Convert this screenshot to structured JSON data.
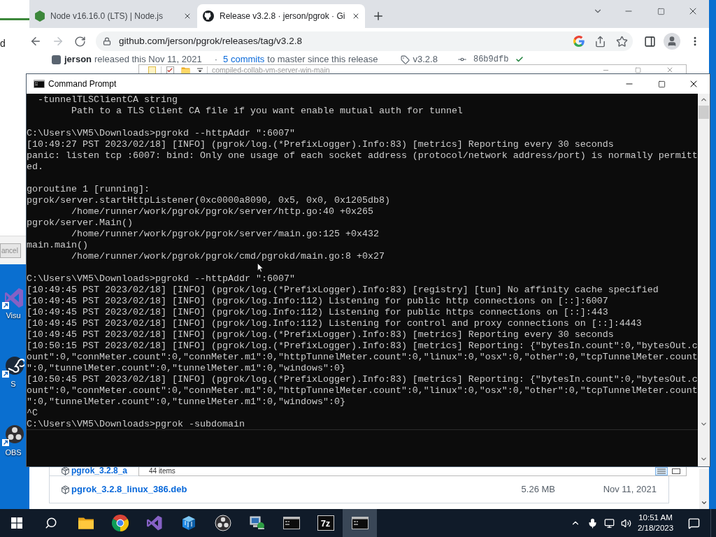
{
  "background_window": {
    "label": "d",
    "button": "ancel"
  },
  "desktop_icons": [
    {
      "kind": "studio",
      "label": "Visu"
    },
    {
      "kind": "disc",
      "label": "S"
    },
    {
      "kind": "obs",
      "label": "OBS"
    }
  ],
  "browser": {
    "tabs": [
      {
        "kind": "node",
        "title": "Node v16.16.0 (LTS) | Node.js",
        "selected": false
      },
      {
        "kind": "github",
        "title": "Release v3.2.8 · jerson/pgrok · Gi",
        "selected": true
      }
    ],
    "url": "github.com/jerson/pgrok/releases/tag/v3.2.8",
    "release": {
      "author": "jerson",
      "released": "released this Nov 11, 2021",
      "separator": "·",
      "commits": "5 commits",
      "since": "to master since this release",
      "tag": "v3.2.8",
      "commit": "86b9dfb"
    },
    "assets": [
      {
        "name": "pgrok_3.2.8_a"
      },
      {
        "name": "pgrok_3.2.8_linux_386.deb",
        "size": "5.26 MB",
        "date": "Nov 11, 2021"
      }
    ]
  },
  "explorer": {
    "title": "compiled-collab-vm-server-win-main",
    "status": "44 items"
  },
  "console": {
    "title": "Command Prompt",
    "blocks": [
      [
        {
          "kind": "option",
          "text": "-tunnelTLSClientCA string"
        },
        {
          "kind": "detail",
          "text": "Path to a TLS Client CA file if you want enable mutual auth for tunnel"
        }
      ],
      [
        {
          "kind": "plain",
          "text": "C:\\Users\\VM5\\Downloads>pgrokd --httpAddr \":6007\""
        },
        {
          "kind": "plain",
          "text": "[10:49:27 PST 2023/02/18] [INFO] (pgrok/log.(*PrefixLogger).Info:83) [metrics] Reporting every 30 seconds"
        },
        {
          "kind": "plain",
          "text": "panic: listen tcp :6007: bind: Only one usage of each socket address (protocol/network address/port) is normally permitt"
        },
        {
          "kind": "plain",
          "text": "ed."
        }
      ],
      [
        {
          "kind": "plain",
          "text": "goroutine 1 [running]:"
        },
        {
          "kind": "plain",
          "text": "pgrok/server.startHttpListener(0xc0000a8090, 0x5, 0x0, 0x1205db8)"
        },
        {
          "kind": "detail",
          "text": "/home/runner/work/pgrok/pgrok/server/http.go:40 +0x265"
        },
        {
          "kind": "plain",
          "text": "pgrok/server.Main()"
        },
        {
          "kind": "detail",
          "text": "/home/runner/work/pgrok/pgrok/server/main.go:125 +0x432"
        },
        {
          "kind": "plain",
          "text": "main.main()"
        },
        {
          "kind": "detail",
          "text": "/home/runner/work/pgrok/pgrok/cmd/pgrokd/main.go:8 +0x27"
        }
      ],
      [
        {
          "kind": "plain",
          "text": "C:\\Users\\VM5\\Downloads>pgrokd --httpAddr \":6007\""
        },
        {
          "kind": "plain",
          "text": "[10:49:45 PST 2023/02/18] [INFO] (pgrok/log.(*PrefixLogger).Info:83) [registry] [tun] No affinity cache specified"
        },
        {
          "kind": "plain",
          "text": "[10:49:45 PST 2023/02/18] [INFO] (pgrok/log.Info:112) Listening for public http connections on [::]:6007"
        },
        {
          "kind": "plain",
          "text": "[10:49:45 PST 2023/02/18] [INFO] (pgrok/log.Info:112) Listening for public https connections on [::]:443"
        },
        {
          "kind": "plain",
          "text": "[10:49:45 PST 2023/02/18] [INFO] (pgrok/log.Info:112) Listening for control and proxy connections on [::]:4443"
        },
        {
          "kind": "plain",
          "text": "[10:49:45 PST 2023/02/18] [INFO] (pgrok/log.(*PrefixLogger).Info:83) [metrics] Reporting every 30 seconds"
        },
        {
          "kind": "plain",
          "text": "[10:50:15 PST 2023/02/18] [INFO] (pgrok/log.(*PrefixLogger).Info:83) [metrics] Reporting: {\"bytesIn.count\":0,\"bytesOut.c"
        },
        {
          "kind": "plain",
          "text": "ount\":0,\"connMeter.count\":0,\"connMeter.m1\":0,\"httpTunnelMeter.count\":0,\"linux\":0,\"osx\":0,\"other\":0,\"tcpTunnelMeter.count"
        },
        {
          "kind": "plain",
          "text": "\":0,\"tunnelMeter.count\":0,\"tunnelMeter.m1\":0,\"windows\":0}"
        },
        {
          "kind": "plain",
          "text": "[10:50:45 PST 2023/02/18] [INFO] (pgrok/log.(*PrefixLogger).Info:83) [metrics] Reporting: {\"bytesIn.count\":0,\"bytesOut.c"
        },
        {
          "kind": "plain",
          "text": "ount\":0,\"connMeter.count\":0,\"connMeter.m1\":0,\"httpTunnelMeter.count\":0,\"linux\":0,\"osx\":0,\"other\":0,\"tcpTunnelMeter.count"
        },
        {
          "kind": "plain",
          "text": "\":0,\"tunnelMeter.count\":0,\"tunnelMeter.m1\":0,\"windows\":0}"
        },
        {
          "kind": "plain",
          "text": "^C"
        },
        {
          "kind": "plain",
          "text": "C:\\Users\\VM5\\Downloads>pgrok -subdomain"
        }
      ]
    ]
  },
  "taskbar": {
    "apps": [
      {
        "kind": "folder",
        "selected": false
      },
      {
        "kind": "browser",
        "selected": false
      },
      {
        "kind": "studio",
        "selected": false
      },
      {
        "kind": "cube",
        "selected": false
      },
      {
        "kind": "obs",
        "selected": false
      },
      {
        "kind": "network",
        "selected": false
      },
      {
        "kind": "console",
        "selected": false
      },
      {
        "kind": "archive",
        "label": "7z",
        "selected": false
      },
      {
        "kind": "console",
        "selected": true
      }
    ],
    "time": "10:51 AM",
    "date": "2/18/2023"
  }
}
